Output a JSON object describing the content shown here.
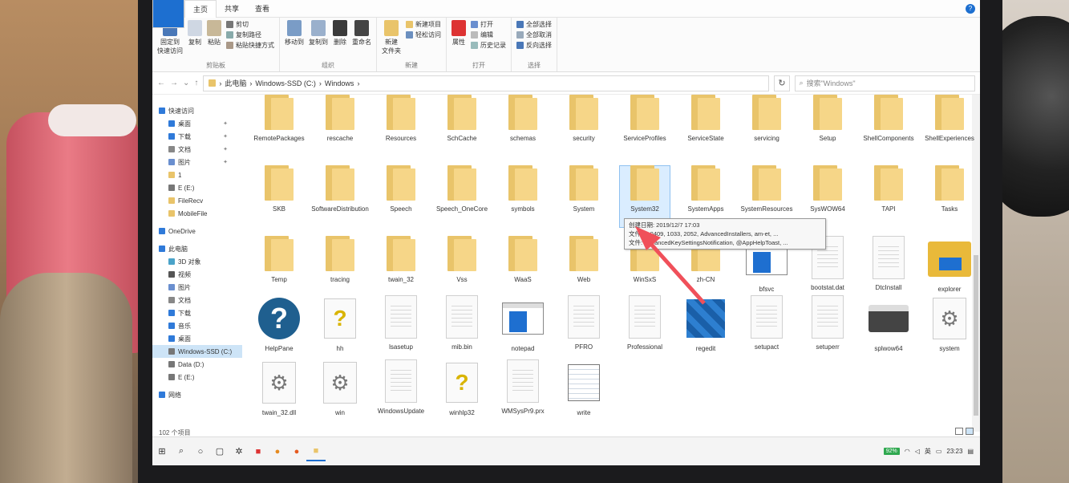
{
  "window": {
    "title": "Windows",
    "tabs": [
      "文件",
      "主页",
      "共享",
      "查看"
    ]
  },
  "ribbon": {
    "clipboard": {
      "label": "剪贴板",
      "pin": "固定到\n快速访问",
      "copy": "复制",
      "paste": "粘贴",
      "cut": "剪切",
      "copy_path": "复制路径",
      "paste_shortcut": "粘贴快捷方式"
    },
    "organize": {
      "label": "组织",
      "move_to": "移动到",
      "copy_to": "复制到",
      "delete": "删除",
      "rename": "重命名"
    },
    "new": {
      "label": "新建",
      "new_folder": "新建\n文件夹",
      "new_item": "新建项目",
      "easy_access": "轻松访问"
    },
    "open": {
      "label": "打开",
      "properties": "属性",
      "open": "打开",
      "edit": "编辑",
      "history": "历史记录"
    },
    "select": {
      "label": "选择",
      "select_all": "全部选择",
      "select_none": "全部取消",
      "invert": "反向选择"
    }
  },
  "address": {
    "crumbs": [
      "此电脑",
      "Windows-SSD (C:)",
      "Windows"
    ],
    "search_placeholder": "搜索\"Windows\""
  },
  "nav": [
    {
      "label": "快速访问",
      "icon": "star-icon",
      "top": true
    },
    {
      "label": "桌面",
      "icon": "desktop-icon",
      "pinned": true
    },
    {
      "label": "下载",
      "icon": "download-icon",
      "pinned": true
    },
    {
      "label": "文档",
      "icon": "document-icon",
      "pinned": true
    },
    {
      "label": "图片",
      "icon": "picture-icon",
      "pinned": true
    },
    {
      "label": "1",
      "icon": "folder-icon"
    },
    {
      "label": "E (E:)",
      "icon": "drive-icon"
    },
    {
      "label": "FileRecv",
      "icon": "folder-icon"
    },
    {
      "label": "MobileFile",
      "icon": "folder-icon"
    },
    {
      "label": "OneDrive",
      "icon": "cloud-icon",
      "top": true
    },
    {
      "label": "此电脑",
      "icon": "computer-icon",
      "top": true
    },
    {
      "label": "3D 对象",
      "icon": "cube-icon"
    },
    {
      "label": "视频",
      "icon": "video-icon"
    },
    {
      "label": "图片",
      "icon": "picture-icon"
    },
    {
      "label": "文档",
      "icon": "document-icon"
    },
    {
      "label": "下载",
      "icon": "download-icon"
    },
    {
      "label": "音乐",
      "icon": "music-icon"
    },
    {
      "label": "桌面",
      "icon": "desktop-icon"
    },
    {
      "label": "Windows-SSD (C:)",
      "icon": "drive-icon",
      "selected": true
    },
    {
      "label": "Data (D:)",
      "icon": "drive-icon"
    },
    {
      "label": "E (E:)",
      "icon": "drive-icon"
    },
    {
      "label": "网络",
      "icon": "network-icon",
      "top": true
    }
  ],
  "items": [
    {
      "name": "RemotePackages",
      "kind": "folder"
    },
    {
      "name": "rescache",
      "kind": "folder"
    },
    {
      "name": "Resources",
      "kind": "folder"
    },
    {
      "name": "SchCache",
      "kind": "folder"
    },
    {
      "name": "schemas",
      "kind": "folder"
    },
    {
      "name": "security",
      "kind": "folder"
    },
    {
      "name": "ServiceProfiles",
      "kind": "folder"
    },
    {
      "name": "ServiceState",
      "kind": "folder"
    },
    {
      "name": "servicing",
      "kind": "folder"
    },
    {
      "name": "Setup",
      "kind": "folder"
    },
    {
      "name": "ShellComponents",
      "kind": "folder"
    },
    {
      "name": "ShellExperiences",
      "kind": "folder"
    },
    {
      "name": "SKB",
      "kind": "folder"
    },
    {
      "name": "SoftwareDistribution",
      "kind": "folder"
    },
    {
      "name": "Speech",
      "kind": "folder"
    },
    {
      "name": "Speech_OneCore",
      "kind": "folder"
    },
    {
      "name": "symbols",
      "kind": "folder"
    },
    {
      "name": "System",
      "kind": "folder"
    },
    {
      "name": "System32",
      "kind": "folder",
      "selected": true
    },
    {
      "name": "SystemApps",
      "kind": "folder"
    },
    {
      "name": "SystemResources",
      "kind": "folder"
    },
    {
      "name": "SysWOW64",
      "kind": "folder"
    },
    {
      "name": "TAPI",
      "kind": "folder"
    },
    {
      "name": "Tasks",
      "kind": "folder"
    },
    {
      "name": "Temp",
      "kind": "folder"
    },
    {
      "name": "tracing",
      "kind": "folder"
    },
    {
      "name": "twain_32",
      "kind": "folder"
    },
    {
      "name": "Vss",
      "kind": "folder"
    },
    {
      "name": "WaaS",
      "kind": "folder"
    },
    {
      "name": "Web",
      "kind": "folder"
    },
    {
      "name": "WinSxS",
      "kind": "folder"
    },
    {
      "name": "zh-CN",
      "kind": "folder"
    },
    {
      "name": "bfsvc",
      "kind": "app"
    },
    {
      "name": "bootstat.dat",
      "kind": "file"
    },
    {
      "name": "DtcInstall",
      "kind": "file"
    },
    {
      "name": "explorer",
      "kind": "explorer"
    },
    {
      "name": "HelpPane",
      "kind": "help"
    },
    {
      "name": "hh",
      "kind": "hh"
    },
    {
      "name": "lsasetup",
      "kind": "file"
    },
    {
      "name": "mib.bin",
      "kind": "file"
    },
    {
      "name": "notepad",
      "kind": "app"
    },
    {
      "name": "PFRO",
      "kind": "file"
    },
    {
      "name": "Professional",
      "kind": "file"
    },
    {
      "name": "regedit",
      "kind": "regedit"
    },
    {
      "name": "setupact",
      "kind": "file"
    },
    {
      "name": "setuperr",
      "kind": "file"
    },
    {
      "name": "splwow64",
      "kind": "printer"
    },
    {
      "name": "system",
      "kind": "gear"
    },
    {
      "name": "twain_32.dll",
      "kind": "gear"
    },
    {
      "name": "win",
      "kind": "gear"
    },
    {
      "name": "WindowsUpdate",
      "kind": "file"
    },
    {
      "name": "winhlp32",
      "kind": "help2"
    },
    {
      "name": "WMSysPr9.prx",
      "kind": "file"
    },
    {
      "name": "write",
      "kind": "write"
    }
  ],
  "tooltip": {
    "line1": "创建日期: 2019/12/7 17:03",
    "line2": "文件夹: 0409, 1033, 2052, AdvancedInstallers, am-et, ...",
    "line3": "文件: AdvancedKeySettingsNotification, @AppHelpToast, ..."
  },
  "status": {
    "count": "102 个项目"
  },
  "taskbar": {
    "battery": "92%",
    "ime": "英",
    "time": "23:23"
  },
  "colors": {
    "accent": "#1d6fd0",
    "folder": "#e9c46a",
    "arrow": "#f0505a"
  }
}
